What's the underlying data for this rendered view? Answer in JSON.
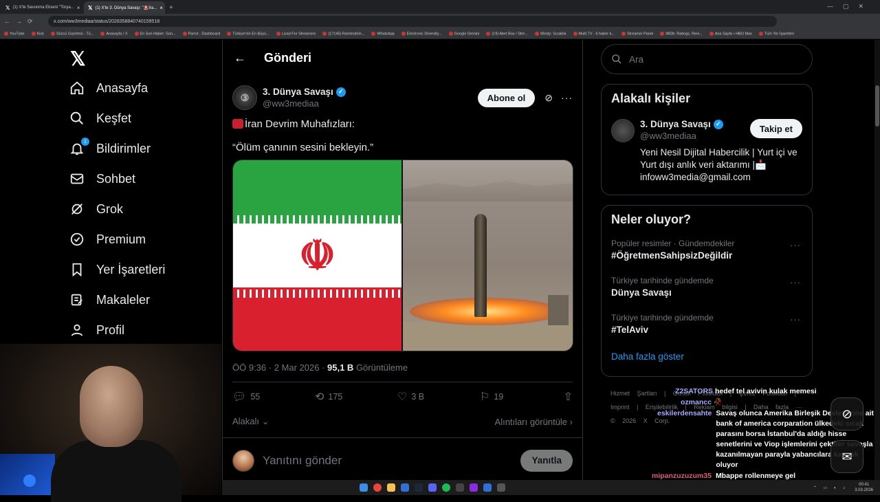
{
  "browser": {
    "tabs": [
      {
        "title": "(1) X'te Savunma Ekseni \"Torya..."
      },
      {
        "title": "(1) X'te 3. Dünya Savaşı: \"🚨İra..."
      }
    ],
    "url": "x.com/ww3mediaa/status/2028358840740159518",
    "bookmarks": [
      "YouTube",
      "Kick",
      "Sözcü Gazetesi - Tü...",
      "Anasayfa / X",
      "En Son Haber: Son...",
      "Parrot - Dashboard",
      "Türkiye'nin En Büyü...",
      "Livad For Streamers",
      "(17145) Rammstein...",
      "WhatsApp",
      "Electronic Diversity...",
      "Google Gemini",
      "(19) Alert Box / Stre...",
      "Windy: Sıcaklık",
      "Multi TV - 6 haber k...",
      "Streamer Panel",
      "IMDb: Ratings, Revi...",
      "Ana Sayfa • HBO Max",
      "Tüm Yer İşaretleri"
    ]
  },
  "nav": {
    "logo": "𝕏",
    "items": [
      {
        "label": "Anasayfa",
        "icon": "home-icon"
      },
      {
        "label": "Keşfet",
        "icon": "search-icon"
      },
      {
        "label": "Bildirimler",
        "icon": "bell-icon",
        "badge": "1"
      },
      {
        "label": "Sohbet",
        "icon": "mail-icon"
      },
      {
        "label": "Grok",
        "icon": "grok-icon"
      },
      {
        "label": "Premium",
        "icon": "verified-badge-icon"
      },
      {
        "label": "Yer İşaretleri",
        "icon": "bookmark-icon"
      },
      {
        "label": "Makaleler",
        "icon": "article-icon"
      },
      {
        "label": "Profil",
        "icon": "person-icon"
      }
    ]
  },
  "post": {
    "header_title": "Gönderi",
    "author_name": "3. Dünya Savaşı",
    "author_handle": "@ww3mediaa",
    "subscribe_label": "Abone ol",
    "line1": "İran Devrim Muhafızları:",
    "line2": "“Ölüm çanının sesini bekleyin.”",
    "timestamp": "ÖÖ 9:36 · 2 Mar 2026 · ",
    "views": "95,1 B",
    "views_label": " Görüntüleme",
    "replies": "55",
    "reposts": "175",
    "likes": "3 B",
    "bookmarks": "19",
    "related_label": "Alakalı",
    "quotes_label": "Alıntıları görüntüle",
    "reply_placeholder": "Yanıtını gönder",
    "reply_button": "Yanıtla"
  },
  "sidebar": {
    "search_placeholder": "Ara",
    "related_title": "Alakalı kişiler",
    "related_name": "3. Dünya Savaşı",
    "related_handle": "@ww3mediaa",
    "follow_label": "Takip et",
    "bio": "Yeni Nesil Dijital Habercilik | Yurt içi ve Yurt dışı anlık veri aktarımı |📩 infoww3media@gmail.com",
    "trends_title": "Neler oluyor?",
    "trends": [
      {
        "meta": "Popüler resimler · Gündemdekiler",
        "name": "#ÖğretmenSahipsizDeğildir"
      },
      {
        "meta": "Türkiye tarihinde gündemde",
        "name": "Dünya Savaşı"
      },
      {
        "meta": "Türkiye tarihinde gündemde",
        "name": "#TelAviv"
      }
    ],
    "show_more": "Daha fazla göster",
    "footer": "Hizmet Şartları | Gizlilik Politikası | Çerez Politikası | Imprint | Erişilebilirlik | Reklam bilgisi | Daha fazla ··· © 2026 X Corp."
  },
  "chat": [
    {
      "user": "Z2SATORS",
      "msg": "hedef tel avivin kulak memesi"
    },
    {
      "user": "ozmancc",
      "msg": "🥀"
    },
    {
      "user": "eskilerdensahte",
      "msg": "Savaş olunca Amerika Birleşik Devletlerine ait bank of america corparation ülkedeki sıcak parasını borsa İstanbul'da aldığı hisse senetlerini ve Viop işlemlerini çektiler savaşla kazanılmayan parayla yabancılara kaynak oluyor"
    },
    {
      "user": "mipanzuzuzum35",
      "msg": "Mbappe rollenmeye gel"
    }
  ],
  "taskbar": {
    "time": "00:41",
    "date": "3.03.2026"
  },
  "colors": {
    "accent": "#1d9bf0",
    "background": "#000000",
    "flag_green": "#2aa440",
    "flag_red": "#d8202e"
  }
}
